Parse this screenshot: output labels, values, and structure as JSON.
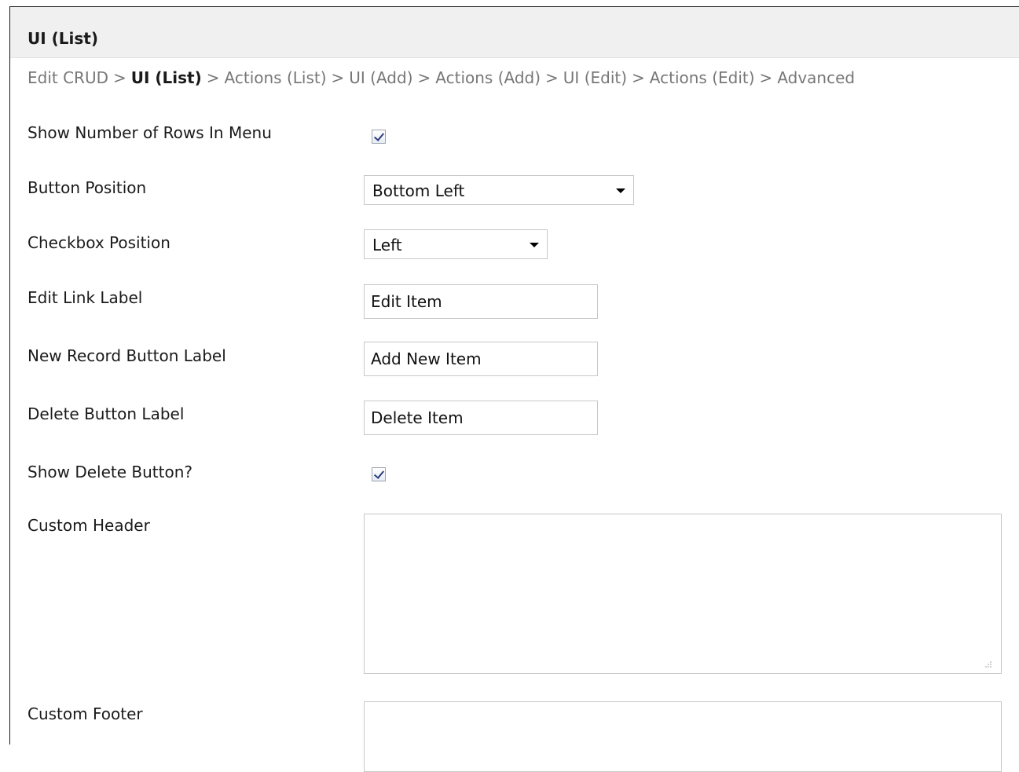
{
  "panel": {
    "title": "UI (List)"
  },
  "breadcrumb": {
    "items": [
      "Edit CRUD",
      "UI (List)",
      "Actions (List)",
      "UI (Add)",
      "Actions (Add)",
      "UI (Edit)",
      "Actions (Edit)",
      "Advanced"
    ],
    "separator": ">",
    "current_index": 1
  },
  "fields": {
    "show_rows": {
      "label": "Show Number of Rows In Menu",
      "checked": true
    },
    "button_position": {
      "label": "Button Position",
      "value": "Bottom Left"
    },
    "checkbox_position": {
      "label": "Checkbox Position",
      "value": "Left"
    },
    "edit_link": {
      "label": "Edit Link Label",
      "value": "Edit Item"
    },
    "new_record": {
      "label": "New Record Button Label",
      "value": "Add New Item"
    },
    "delete_label": {
      "label": "Delete Button Label",
      "value": "Delete Item"
    },
    "show_delete": {
      "label": "Show Delete Button?",
      "checked": true
    },
    "custom_header": {
      "label": "Custom Header",
      "value": ""
    },
    "custom_footer": {
      "label": "Custom Footer",
      "value": ""
    }
  },
  "colors": {
    "header_bg": "#f0f0f0",
    "check_mark": "#2b3d7a",
    "muted_text": "#777777"
  }
}
